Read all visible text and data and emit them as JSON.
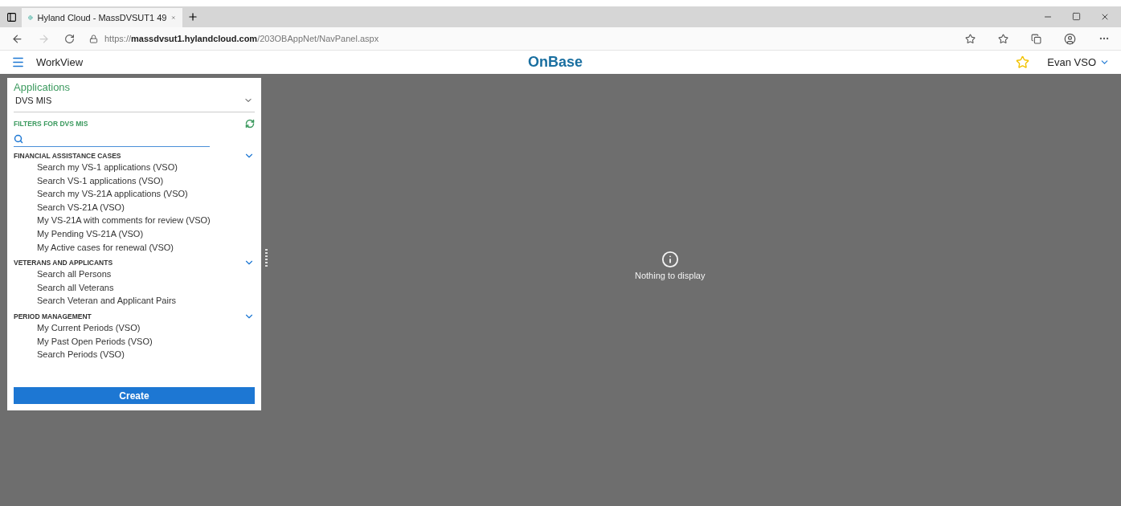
{
  "browser": {
    "tab_title": "Hyland Cloud - MassDVSUT1 49",
    "url": "https://**massdvsut1.hylandcloud.com**/203OBAppNet/NavPanel.aspx"
  },
  "header": {
    "module": "WorkView",
    "logo": "OnBase",
    "user": "Evan VSO"
  },
  "panel": {
    "applications_label": "Applications",
    "application": "DVS MIS",
    "filters_title": "FILTERS FOR DVS MIS",
    "groups": [
      {
        "title": "FINANCIAL ASSISTANCE CASES",
        "expanded": true,
        "items": [
          "Search my VS-1 applications (VSO)",
          "Search VS-1 applications (VSO)",
          "Search my VS-21A applications (VSO)",
          "Search VS-21A (VSO)",
          "My VS-21A with comments for review (VSO)",
          "My Pending VS-21A (VSO)",
          "My Active cases for renewal (VSO)"
        ]
      },
      {
        "title": "VETERANS AND APPLICANTS",
        "expanded": true,
        "items": [
          "Search all Persons",
          "Search all Veterans",
          "Search Veteran and Applicant Pairs"
        ]
      },
      {
        "title": "PERIOD MANAGEMENT",
        "expanded": true,
        "items": [
          "My Current Periods (VSO)",
          "My Past Open Periods (VSO)",
          "Search Periods (VSO)"
        ]
      }
    ],
    "create_button": "Create"
  },
  "main": {
    "message": "Nothing to display"
  }
}
